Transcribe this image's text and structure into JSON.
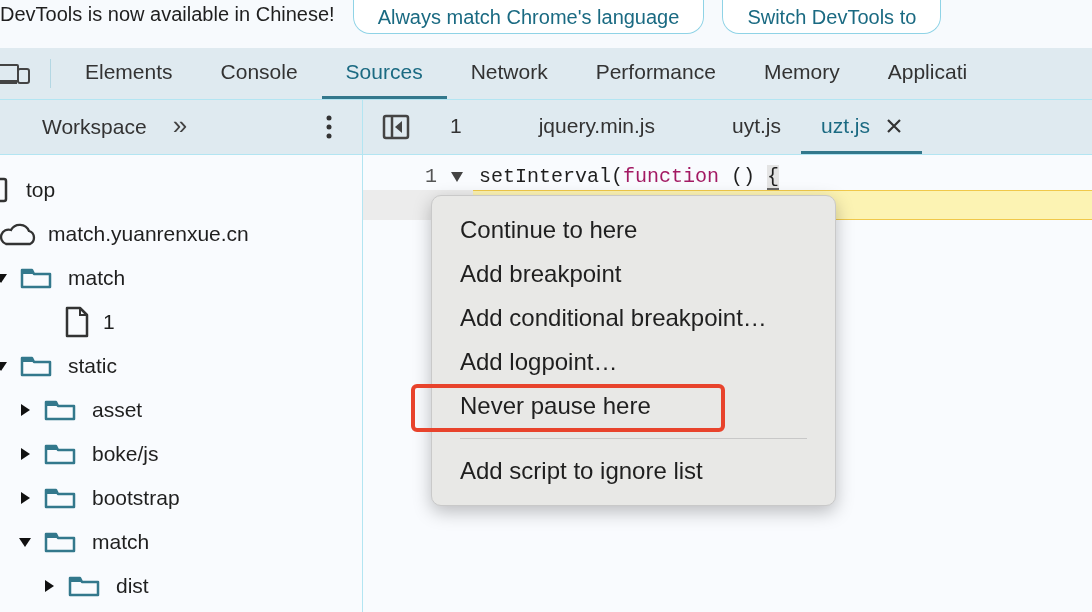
{
  "banner": {
    "message": "DevTools is now available in Chinese!",
    "buttons": [
      "Always match Chrome's language",
      "Switch DevTools to"
    ]
  },
  "main_tabs": [
    {
      "label": "Elements",
      "selected": false
    },
    {
      "label": "Console",
      "selected": false
    },
    {
      "label": "Sources",
      "selected": true
    },
    {
      "label": "Network",
      "selected": false
    },
    {
      "label": "Performance",
      "selected": false
    },
    {
      "label": "Memory",
      "selected": false
    },
    {
      "label": "Applicati",
      "selected": false
    }
  ],
  "sidebar": {
    "tab": "Workspace",
    "more": "»",
    "tree": [
      {
        "kind": "frame",
        "label": "top"
      },
      {
        "kind": "domain",
        "label": "match.yuanrenxue.cn"
      },
      {
        "kind": "folder",
        "label": "match",
        "expanded": true,
        "children": [
          {
            "kind": "file",
            "label": "1"
          }
        ]
      },
      {
        "kind": "folder",
        "label": "static",
        "expanded": true,
        "children": [
          {
            "kind": "folder",
            "label": "asset",
            "expanded": false
          },
          {
            "kind": "folder",
            "label": "boke/js",
            "expanded": false
          },
          {
            "kind": "folder",
            "label": "bootstrap",
            "expanded": false
          },
          {
            "kind": "folder",
            "label": "match",
            "expanded": true,
            "children": [
              {
                "kind": "folder",
                "label": "dist",
                "expanded": false
              }
            ]
          }
        ]
      }
    ]
  },
  "editor_tabs": [
    {
      "label": "1",
      "selected": false,
      "closable": false
    },
    {
      "label": "jquery.min.js",
      "selected": false,
      "closable": false
    },
    {
      "label": "uyt.js",
      "selected": false,
      "closable": false
    },
    {
      "label": "uzt.js",
      "selected": true,
      "closable": true
    }
  ],
  "code": {
    "line_number": "1",
    "tokens": [
      {
        "kind": "plain",
        "text": "setInterval("
      },
      {
        "kind": "keyword",
        "text": "function"
      },
      {
        "kind": "plain",
        "text": " () "
      },
      {
        "kind": "bracket",
        "text": "{"
      }
    ]
  },
  "context_menu": [
    {
      "kind": "item",
      "label": "Continue to here",
      "highlighted": false
    },
    {
      "kind": "item",
      "label": "Add breakpoint",
      "highlighted": false
    },
    {
      "kind": "item",
      "label": "Add conditional breakpoint…",
      "highlighted": false
    },
    {
      "kind": "item",
      "label": "Add logpoint…",
      "highlighted": false
    },
    {
      "kind": "item",
      "label": "Never pause here",
      "highlighted": true
    },
    {
      "kind": "separator"
    },
    {
      "kind": "item",
      "label": "Add script to ignore list",
      "highlighted": false
    }
  ]
}
